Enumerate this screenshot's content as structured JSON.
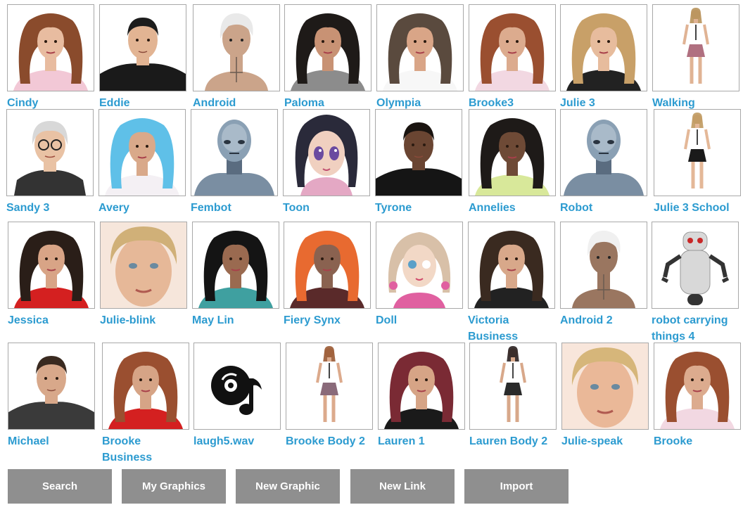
{
  "gallery": {
    "items": [
      {
        "label": "Cindy",
        "kind": "woman",
        "skin": "#e8bca0",
        "hair": "#8a4b2c",
        "shirt": "#f2c8d6"
      },
      {
        "label": "Eddie",
        "kind": "man",
        "skin": "#e2b493",
        "hair": "#1c1c1c",
        "shirt": "#1a1a1a"
      },
      {
        "label": "Android",
        "kind": "android",
        "skin": "#cba48a",
        "hair": "#e9e9e9",
        "shirt": "#cba48a"
      },
      {
        "label": "Paloma",
        "kind": "woman",
        "skin": "#c89274",
        "hair": "#1e1a18",
        "shirt": "#8c8c8c"
      },
      {
        "label": "Olympia",
        "kind": "woman",
        "skin": "#d9a587",
        "hair": "#5a4a3e",
        "shirt": "#f7f7f7"
      },
      {
        "label": "Brooke3",
        "kind": "woman",
        "skin": "#dcab8e",
        "hair": "#9a4f30",
        "shirt": "#f2d8e2"
      },
      {
        "label": "Julie 3",
        "kind": "woman",
        "skin": "#e7bc9d",
        "hair": "#c8a068",
        "shirt": "#222222"
      },
      {
        "label": "Walking",
        "kind": "body",
        "skin": "#e0b394",
        "hair": "#b8925a",
        "shirt": "#ffffff",
        "bottom": "#b07080"
      },
      {
        "label": "Sandy 3",
        "kind": "glasses",
        "skin": "#e9c2a4",
        "hair": "#d8d8d8",
        "shirt": "#333333"
      },
      {
        "label": "Avery",
        "kind": "woman",
        "skin": "#d9a98a",
        "hair": "#5fc0e8",
        "shirt": "#f4f0f4"
      },
      {
        "label": "Fembot",
        "kind": "robot",
        "skin": "#8aa0b4",
        "hair": "#5a6c80",
        "shirt": "#7a8ea2"
      },
      {
        "label": "Toon",
        "kind": "toon",
        "skin": "#f0d0c0",
        "hair": "#2a2a3a",
        "shirt": "#e4a8c4"
      },
      {
        "label": "Tyrone",
        "kind": "man",
        "skin": "#6a4532",
        "hair": "#1a1410",
        "shirt": "#151515"
      },
      {
        "label": "Annelies",
        "kind": "woman",
        "skin": "#6e4a36",
        "hair": "#1e1a18",
        "shirt": "#d8e89a"
      },
      {
        "label": "Robot",
        "kind": "robot",
        "skin": "#8aa0b4",
        "hair": "#5a6c80",
        "shirt": "#7a8ea2"
      },
      {
        "label": "Julie 3 School",
        "kind": "body",
        "skin": "#e4b898",
        "hair": "#c09a60",
        "shirt": "#ffffff",
        "bottom": "#1a1a1a"
      },
      {
        "label": "Jessica",
        "kind": "woman",
        "skin": "#d8a486",
        "hair": "#2a1e18",
        "shirt": "#d42020"
      },
      {
        "label": "Julie-blink",
        "kind": "closeup",
        "skin": "#e6b898",
        "hair": "#d0b078",
        "shirt": "#e6b898"
      },
      {
        "label": "May Lin",
        "kind": "woman",
        "skin": "#9a6a50",
        "hair": "#141414",
        "shirt": "#3fa0a0"
      },
      {
        "label": "Fiery Synx",
        "kind": "woman",
        "skin": "#8a6250",
        "hair": "#e86a30",
        "shirt": "#5a2a2a"
      },
      {
        "label": "Doll",
        "kind": "doll",
        "skin": "#f2d8c6",
        "hair": "#d8c0a8",
        "shirt": "#e060a0"
      },
      {
        "label": "Victoria Business",
        "kind": "woman",
        "skin": "#d8a88a",
        "hair": "#3a2a20",
        "shirt": "#222222"
      },
      {
        "label": "Android 2",
        "kind": "android",
        "skin": "#9a7660",
        "hair": "#f0f0f0",
        "shirt": "#9a7660"
      },
      {
        "label": "robot carrying things 4",
        "kind": "mech",
        "skin": "#d8d8d8",
        "hair": "#c82828",
        "shirt": "#333333"
      },
      {
        "label": "Michael",
        "kind": "man",
        "skin": "#d8a88a",
        "hair": "#3a2a20",
        "shirt": "#3a3a3a"
      },
      {
        "label": "Brooke Business",
        "kind": "woman",
        "skin": "#d6a486",
        "hair": "#9a4f30",
        "shirt": "#d42020"
      },
      {
        "label": "laugh5.wav",
        "kind": "audio",
        "skin": "#111111",
        "hair": "#111111",
        "shirt": "#111111"
      },
      {
        "label": "Brooke Body 2",
        "kind": "body",
        "skin": "#dcaa8c",
        "hair": "#9a5a34",
        "shirt": "#ffffff",
        "bottom": "#8a6a7a"
      },
      {
        "label": "Lauren 1",
        "kind": "woman",
        "skin": "#d6a486",
        "hair": "#7a2a34",
        "shirt": "#1a1a1a"
      },
      {
        "label": "Lauren Body 2",
        "kind": "body",
        "skin": "#d8a88a",
        "hair": "#2a2020",
        "shirt": "#ffffff",
        "bottom": "#2a2a2a"
      },
      {
        "label": "Julie-speak",
        "kind": "closeup",
        "skin": "#eab898",
        "hair": "#d6b67a",
        "shirt": "#eab898"
      },
      {
        "label": "Brooke",
        "kind": "woman",
        "skin": "#dcab8e",
        "hair": "#9a4f30",
        "shirt": "#f2d8e2"
      }
    ]
  },
  "toolbar": {
    "search_label": "Search",
    "my_graphics_label": "My Graphics",
    "new_graphic_label": "New Graphic",
    "new_link_label": "New Link",
    "import_label": "Import"
  },
  "colors": {
    "link": "#2c9bd0",
    "button_bg": "#8f8f8f",
    "button_text": "#ffffff",
    "thumb_border": "#a8a8a8"
  }
}
